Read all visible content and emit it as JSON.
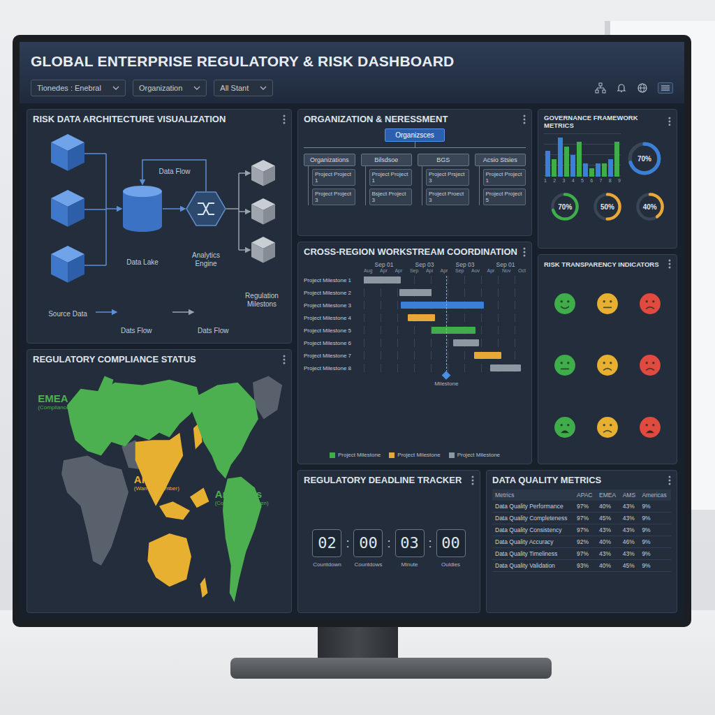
{
  "window": {
    "title": "GLOBAL ENTERPRISE REGULATORY & RISK DASHBOARD"
  },
  "filters": [
    {
      "label": "Tionedes : Enebral"
    },
    {
      "label": "Organization"
    },
    {
      "label": "All Stant"
    }
  ],
  "architecture": {
    "title": "RISK DATA ARCHITECTURE VISUALIZATION",
    "flow_label": "Data Flow",
    "source_label": "Source Data",
    "lake_label": "Data Lake",
    "engine_label": "Analytics Engine",
    "target_label": "Regulation Milestons",
    "legend": [
      {
        "label": "Dats Flow",
        "color": "#5b8fd6"
      },
      {
        "label": "Dats Flow",
        "color": "#9aa3ad"
      }
    ]
  },
  "organization": {
    "title": "ORGANIZATION & NERESSMENT",
    "root": {
      "label": "Organizsces",
      "selected": true
    },
    "groups": [
      {
        "label": "Organizations",
        "children": [
          "Project Project 1",
          "Project Project 3"
        ]
      },
      {
        "label": "Bilsdsoe",
        "children": [
          "Project Project 1",
          "Bsject Project 3"
        ]
      },
      {
        "label": "BGS",
        "children": [
          "Project Prsject 3",
          "Project Proect 3"
        ]
      },
      {
        "label": "Acsio Stsies",
        "children": [
          "Project Project 1",
          "Project Project 5"
        ]
      }
    ]
  },
  "governance": {
    "title": "GOVERNANCE FRAMEWORK METRICS",
    "series": [
      {
        "color": "#3b7fd9",
        "values": [
          6,
          9,
          5,
          3,
          3,
          4
        ]
      },
      {
        "color": "#3fae4a",
        "values": [
          4,
          7,
          8,
          2,
          3,
          8
        ]
      }
    ],
    "ticks": [
      "1",
      "2",
      "3",
      "4",
      "5",
      "6",
      "7",
      "8",
      "9"
    ],
    "gauges": [
      {
        "label": "70%",
        "level": 0.7,
        "color": "#3b7fd9"
      },
      {
        "label": "70%",
        "level": 0.7,
        "color": "#3fae4a"
      },
      {
        "label": "50%",
        "level": 0.5,
        "color": "#e8a838"
      },
      {
        "label": "40%",
        "level": 0.4,
        "color": "#e8a838"
      }
    ]
  },
  "workstream": {
    "title": "CROSS-REGION WORKSTREAM COORDINATION",
    "ticks": [
      "Sep 01",
      "Sep 03",
      "Sep 03",
      "Sep 01"
    ],
    "subticks": [
      "Aug",
      "Apr",
      "Apr",
      "Sep",
      "Api",
      "Apr",
      "Sep",
      "Aov",
      "Apr",
      "Nov",
      "Oct"
    ],
    "rows": [
      {
        "label": "Project Milestone 1",
        "start": 0,
        "end": 23,
        "color": "#8e98a3"
      },
      {
        "label": "Project Milestone 2",
        "start": 22,
        "end": 42,
        "color": "#8e98a3"
      },
      {
        "label": "Project Milestone 3",
        "start": 23,
        "end": 74,
        "color": "#3b7fd9"
      },
      {
        "label": "Project Milestone 4",
        "start": 27,
        "end": 44,
        "color": "#e8a838"
      },
      {
        "label": "Project Milestone 5",
        "start": 42,
        "end": 69,
        "color": "#3fae4a"
      },
      {
        "label": "Project Milestone 6",
        "start": 55,
        "end": 71,
        "color": "#8e98a3"
      },
      {
        "label": "Project Milestone 7",
        "start": 68,
        "end": 85,
        "color": "#e8a838"
      },
      {
        "label": "Project Milestone 8",
        "start": 78,
        "end": 97,
        "color": "#8e98a3"
      }
    ],
    "milestone": {
      "label": "Milestone",
      "at": 51
    },
    "legend": [
      {
        "label": "Project Milestone",
        "color": "#3fae4a"
      },
      {
        "label": "Project Milestone",
        "color": "#e8a838"
      },
      {
        "label": "Project Milestone",
        "color": "#8e98a3"
      }
    ]
  },
  "risk": {
    "title": "RISK TRANSPARENCY INDICATORS",
    "indicators": [
      {
        "kind": "smile",
        "color": "#3fae4a"
      },
      {
        "kind": "neutral",
        "color": "#e8b030"
      },
      {
        "kind": "frown",
        "color": "#e04a3f"
      },
      {
        "kind": "neutral",
        "color": "#3fae4a"
      },
      {
        "kind": "frown",
        "color": "#e8b030"
      },
      {
        "kind": "frown",
        "color": "#e04a3f"
      },
      {
        "kind": "alert",
        "color": "#3fae4a"
      },
      {
        "kind": "frown",
        "color": "#e8b030"
      },
      {
        "kind": "alert",
        "color": "#e04a3f"
      }
    ]
  },
  "compliance": {
    "title": "REGULATORY COMPLIANCE STATUS",
    "regions": [
      {
        "name": "EMEA",
        "status": "(Compliance - Green)",
        "color": "#4caf50"
      },
      {
        "name": "APAC",
        "status": "(Warning - Amber)",
        "color": "#e8b030"
      },
      {
        "name": "Americas",
        "status": "(Compliance - Green)",
        "color": "#4caf50"
      }
    ]
  },
  "deadline": {
    "title": "REGULATORY DEADLINE TRACKER",
    "separator": ":",
    "units": [
      {
        "value": "02",
        "label": "Countdown"
      },
      {
        "value": "00",
        "label": "Countdows"
      },
      {
        "value": "03",
        "label": "Minute"
      },
      {
        "value": "00",
        "label": "Ouldies"
      }
    ]
  },
  "quality": {
    "title": "DATA QUALITY METRICS",
    "columns": [
      "Metrics",
      "APAC",
      "EMEA",
      "AMS",
      "Americas"
    ],
    "rows": [
      [
        "Data Quality Performance",
        "97%",
        "40%",
        "43%",
        "9%"
      ],
      [
        "Data Quality Completeness",
        "97%",
        "45%",
        "43%",
        "9%"
      ],
      [
        "Data Quality Consistency",
        "97%",
        "43%",
        "43%",
        "9%"
      ],
      [
        "Data Quality Accuracy",
        "92%",
        "40%",
        "46%",
        "9%"
      ],
      [
        "Data Quality Timeliness",
        "97%",
        "43%",
        "43%",
        "9%"
      ],
      [
        "Data Quality Validation",
        "93%",
        "40%",
        "45%",
        "9%"
      ]
    ]
  }
}
